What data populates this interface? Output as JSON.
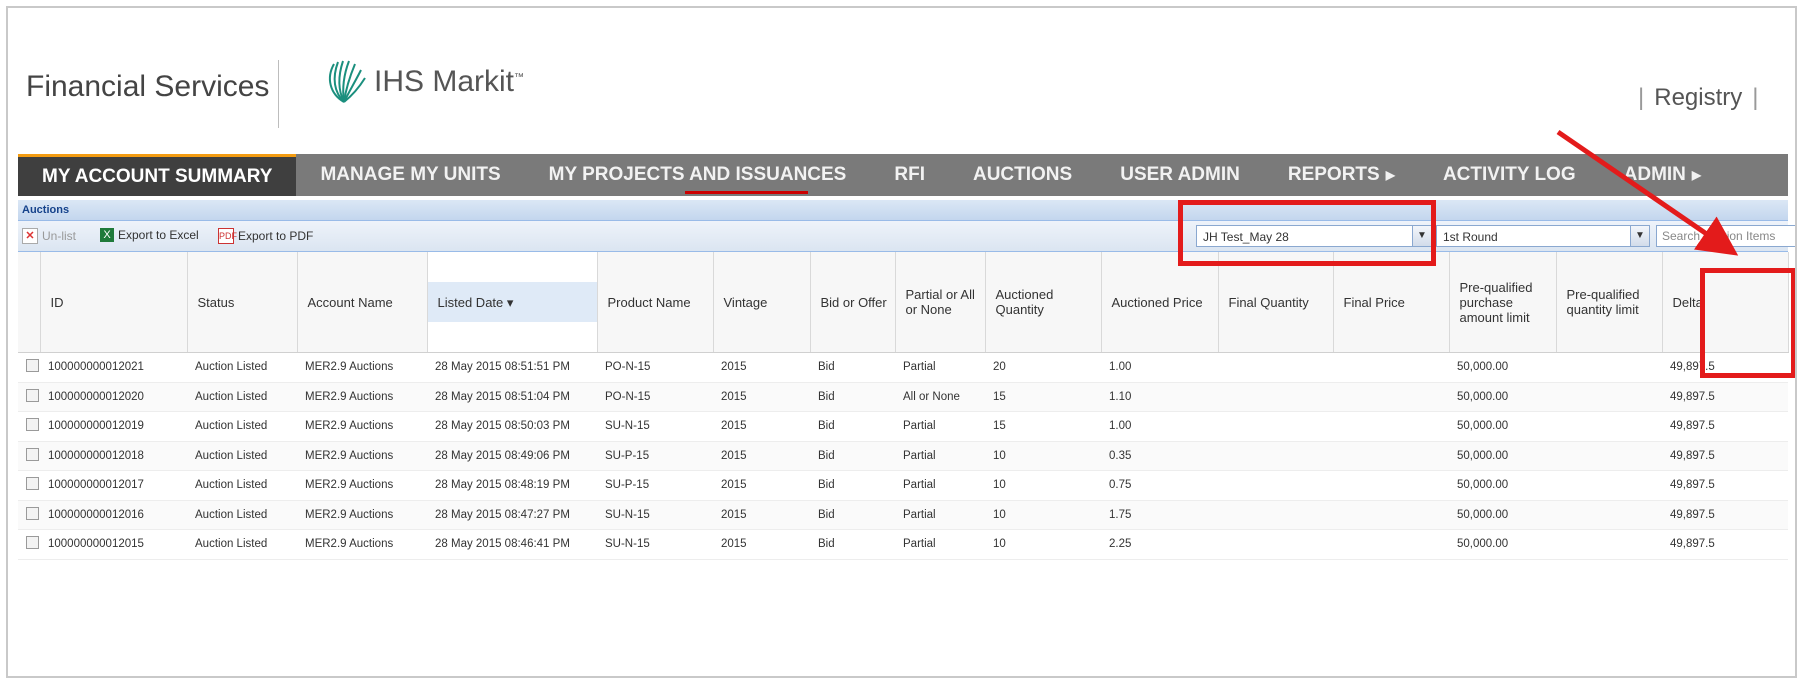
{
  "header": {
    "brand": "Financial Services",
    "logo_name": "IHS Markit",
    "logo_mark": "™",
    "registry": "Registry",
    "pipe": "|"
  },
  "nav": [
    {
      "label": "MY ACCOUNT SUMMARY"
    },
    {
      "label": "MANAGE MY UNITS"
    },
    {
      "label": "MY PROJECTS AND ISSUANCES"
    },
    {
      "label": "RFI"
    },
    {
      "label": "AUCTIONS"
    },
    {
      "label": "USER ADMIN"
    },
    {
      "label": "REPORTS"
    },
    {
      "label": "ACTIVITY LOG"
    },
    {
      "label": "ADMIN"
    }
  ],
  "panel": {
    "title": "Auctions",
    "toolbar": {
      "unlist": "Un-list",
      "export_excel": "Export to Excel",
      "export_pdf": "Export to PDF",
      "auction_select": "JH Test_May 28",
      "round_select": "1st Round",
      "search_placeholder": "Search Auction Items"
    }
  },
  "columns": [
    "ID",
    "Status",
    "Account Name",
    "Listed Date",
    "Product Name",
    "Vintage",
    "Bid or Offer",
    "Partial or All or None",
    "Auctioned Quantity",
    "Auctioned Price",
    "Final Quantity",
    "Final Price",
    "Pre-qualified purchase amount limit",
    "Pre-qualified quantity limit",
    "Delta"
  ],
  "rows": [
    [
      "100000000012021",
      "Auction Listed",
      "MER2.9 Auctions",
      "28 May 2015 08:51:51 PM",
      "PO-N-15",
      "2015",
      "Bid",
      "Partial",
      "20",
      "1.00",
      "",
      "",
      "50,000.00",
      "",
      "49,897.5"
    ],
    [
      "100000000012020",
      "Auction Listed",
      "MER2.9 Auctions",
      "28 May 2015 08:51:04 PM",
      "PO-N-15",
      "2015",
      "Bid",
      "All or None",
      "15",
      "1.10",
      "",
      "",
      "50,000.00",
      "",
      "49,897.5"
    ],
    [
      "100000000012019",
      "Auction Listed",
      "MER2.9 Auctions",
      "28 May 2015 08:50:03 PM",
      "SU-N-15",
      "2015",
      "Bid",
      "Partial",
      "15",
      "1.00",
      "",
      "",
      "50,000.00",
      "",
      "49,897.5"
    ],
    [
      "100000000012018",
      "Auction Listed",
      "MER2.9 Auctions",
      "28 May 2015 08:49:06 PM",
      "SU-P-15",
      "2015",
      "Bid",
      "Partial",
      "10",
      "0.35",
      "",
      "",
      "50,000.00",
      "",
      "49,897.5"
    ],
    [
      "100000000012017",
      "Auction Listed",
      "MER2.9 Auctions",
      "28 May 2015 08:48:19 PM",
      "SU-P-15",
      "2015",
      "Bid",
      "Partial",
      "10",
      "0.75",
      "",
      "",
      "50,000.00",
      "",
      "49,897.5"
    ],
    [
      "100000000012016",
      "Auction Listed",
      "MER2.9 Auctions",
      "28 May 2015 08:47:27 PM",
      "SU-N-15",
      "2015",
      "Bid",
      "Partial",
      "10",
      "1.75",
      "",
      "",
      "50,000.00",
      "",
      "49,897.5"
    ],
    [
      "100000000012015",
      "Auction Listed",
      "MER2.9 Auctions",
      "28 May 2015 08:46:41 PM",
      "SU-N-15",
      "2015",
      "Bid",
      "Partial",
      "10",
      "2.25",
      "",
      "",
      "50,000.00",
      "",
      "49,897.5"
    ]
  ],
  "colors": {
    "annotation": "#e31b1b",
    "nav_bg": "#7a7a7a",
    "nav_active_bg": "#3f3f3f",
    "nav_active_accent": "#f39c12",
    "panel_title": "#15428b"
  }
}
